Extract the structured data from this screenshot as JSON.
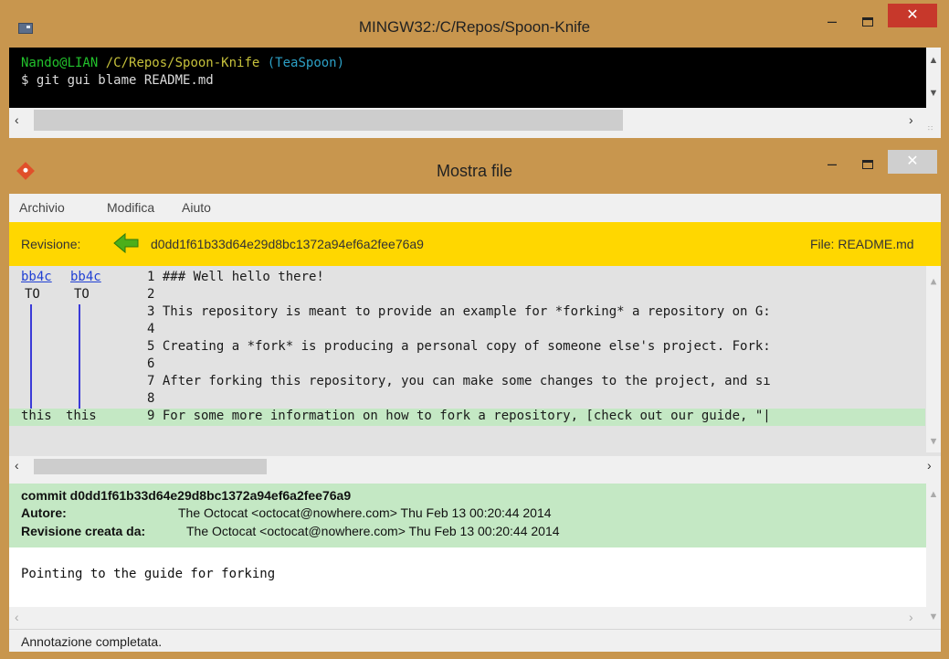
{
  "terminal": {
    "title": "MINGW32:/C/Repos/Spoon-Knife",
    "prompt_user": "Nando@LIAN",
    "prompt_path": "/C/Repos/Spoon-Knife",
    "prompt_branch": "(TeaSpoon)",
    "command": "$ git gui blame README.md",
    "window_controls": {
      "minimize": "–",
      "close": "✕"
    }
  },
  "gitgui": {
    "title": "Mostra file",
    "menu": [
      "Archivio",
      "Modifica",
      "Aiuto"
    ],
    "revision_label": "Revisione:",
    "revision_hash": "d0dd1f61b33d64e29d8bc1372a94ef6a2fee76a9",
    "file_info": "File: README.md",
    "blame_rows": [
      {
        "a": "bb4c",
        "b": "bb4c",
        "line": "1 ### Well hello there!"
      },
      {
        "a": "TO",
        "b": "TO",
        "line": "2"
      },
      {
        "a": "",
        "b": "",
        "line": "3 This repository is meant to provide an example for *forking* a repository on G:"
      },
      {
        "a": "",
        "b": "",
        "line": "4"
      },
      {
        "a": "",
        "b": "",
        "line": "5 Creating a *fork* is producing a personal copy of someone else's project. Fork:"
      },
      {
        "a": "",
        "b": "",
        "line": "6"
      },
      {
        "a": "",
        "b": "",
        "line": "7 After forking this repository, you can make some changes to the project, and sı"
      },
      {
        "a": "",
        "b": "",
        "line": "8"
      },
      {
        "a": "this",
        "b": "this",
        "line": "9 For some more information on how to fork a repository, [check out our guide, \"|"
      }
    ],
    "commit": {
      "line1": "commit d0dd1f61b33d64e29d8bc1372a94ef6a2fee76a9",
      "author_label": "Autore:",
      "author_value": "The Octocat <octocat@nowhere.com>  Thu Feb 13 00:20:44 2014",
      "committer_label": "Revisione creata da:",
      "committer_value": "The Octocat <octocat@nowhere.com>  Thu Feb 13 00:20:44 2014",
      "message": "Pointing to the guide for forking"
    },
    "status": "Annotazione completata.",
    "colors": {
      "revision_bar": "#ffd700",
      "highlight": "#c4e8c4",
      "link": "#1f3fd4",
      "arrow": "#4caf1a"
    },
    "icons": [
      "git-logo-icon",
      "back-arrow-icon",
      "minimize-icon",
      "maximize-icon",
      "close-icon"
    ]
  }
}
